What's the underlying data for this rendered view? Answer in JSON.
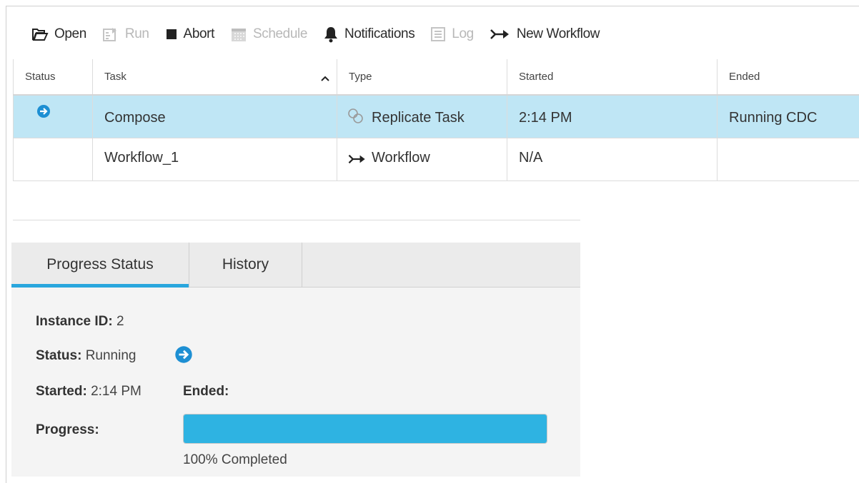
{
  "toolbar": {
    "open": "Open",
    "run": "Run",
    "abort": "Abort",
    "schedule": "Schedule",
    "notifications": "Notifications",
    "log": "Log",
    "new_workflow": "New Workflow"
  },
  "table": {
    "columns": [
      "Status",
      "Task",
      "Type",
      "Started",
      "Ended"
    ],
    "sort_column": "Task",
    "rows": [
      {
        "status_icon": "running-arrow-icon",
        "task": "Compose",
        "type_icon": "replicate-task-icon",
        "type": "Replicate Task",
        "started": "2:14 PM",
        "ended": "Running CDC",
        "selected": true
      },
      {
        "status_icon": "",
        "task": "Workflow_1",
        "type_icon": "workflow-arrow-icon",
        "type": "Workflow",
        "started": "N/A",
        "ended": "",
        "selected": false
      }
    ]
  },
  "panel": {
    "tabs": [
      "Progress Status",
      "History"
    ],
    "active_tab": "Progress Status",
    "instance_id_label": "Instance ID:",
    "instance_id": "2",
    "status_label": "Status:",
    "status": "Running",
    "started_label": "Started:",
    "started": "2:14 PM",
    "ended_label": "Ended:",
    "ended": "",
    "progress_label": "Progress:",
    "progress_percent": 100,
    "progress_text": "100% Completed"
  },
  "colors": {
    "accent": "#2aa6dd",
    "selection": "#bfe6f5",
    "progress_fill": "#2eb3e2"
  }
}
